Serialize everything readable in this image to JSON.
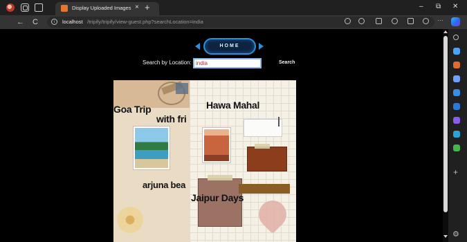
{
  "browser": {
    "tab_title": "Display Uploaded Images",
    "tab_close": "×",
    "new_tab": "+",
    "url_host": "localhost",
    "url_path": "/tripify/tripify/view-guest.php?searchLocation=india",
    "window_controls": {
      "minimize": "–",
      "restore": "⧉",
      "close": "✕"
    },
    "nav": {
      "back": "←",
      "refresh": "C"
    }
  },
  "page": {
    "home_label": "HOME",
    "search": {
      "label": "Search by Location:",
      "value": "india",
      "button": "Search"
    }
  },
  "collage": {
    "captions": {
      "goa": "Goa Trip",
      "friends": "with fri",
      "hawa": "Hawa Mahal",
      "arjuna": "arjuna bea",
      "jaipur": "Jaipur Days"
    }
  },
  "sidebar": {
    "plus": "+",
    "icon_colors": [
      "#4aa3ff",
      "#e06b2c",
      "#6ea0ff",
      "#3a8ee6",
      "#2a7ad9",
      "#8a5cf0",
      "#2ca4d8",
      "#47b64a"
    ]
  }
}
